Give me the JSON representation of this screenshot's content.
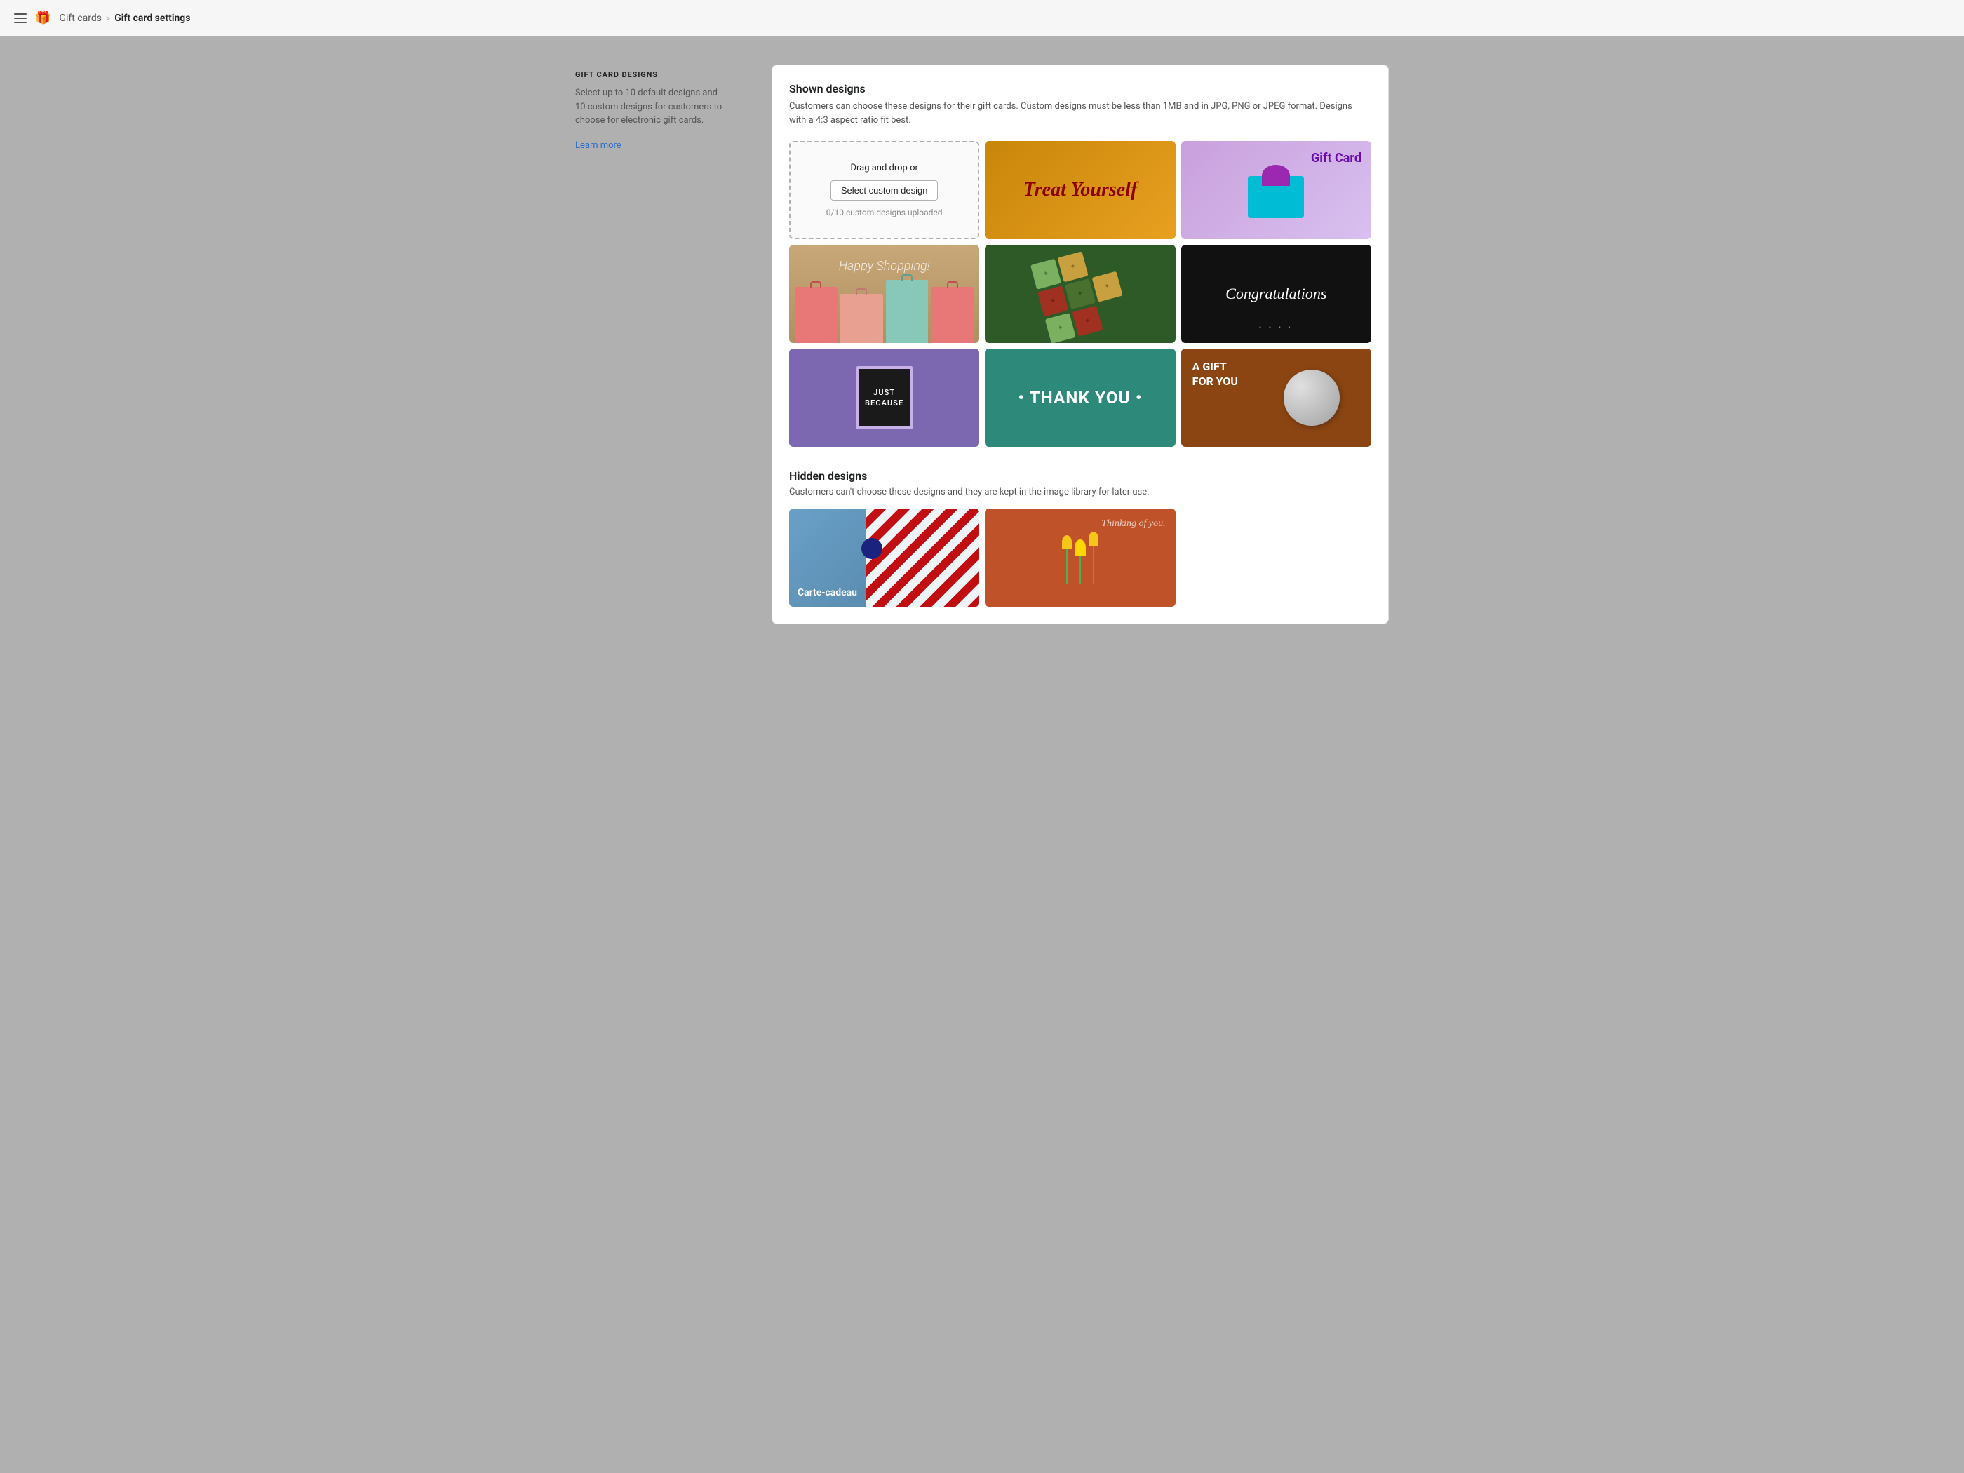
{
  "header": {
    "hamburger_label": "Menu",
    "gift_card_link": "Gift cards",
    "separator": ">",
    "current_page": "Gift card settings"
  },
  "sidebar": {
    "section_title": "GIFT CARD DESIGNS",
    "description": "Select up to 10 default designs and 10 custom designs for customers to choose for electronic gift cards.",
    "learn_more_label": "Learn more"
  },
  "shown_designs": {
    "title": "Shown designs",
    "description": "Customers can choose these designs for their gift cards. Custom designs must be less than 1MB and in JPG, PNG or JPEG format. Designs with a 4:3 aspect ratio fit best.",
    "upload_cell": {
      "drag_drop_text": "Drag and drop or",
      "button_label": "Select custom design",
      "count_text": "0/10 custom designs uploaded"
    },
    "designs": [
      {
        "id": "treat-yourself",
        "alt": "Treat Yourself gift card design"
      },
      {
        "id": "gift-card",
        "alt": "Gift Card with bow design"
      },
      {
        "id": "happy-shopping",
        "alt": "Happy Shopping gift card design"
      },
      {
        "id": "gift-boxes",
        "alt": "Gift boxes design"
      },
      {
        "id": "congratulations",
        "alt": "Congratulations gift card design"
      },
      {
        "id": "just-because",
        "alt": "Just Because letterboard design"
      },
      {
        "id": "thank-you",
        "alt": "Thank You gift card design"
      },
      {
        "id": "gift-for-you",
        "alt": "A Gift For You design"
      }
    ]
  },
  "hidden_designs": {
    "title": "Hidden designs",
    "description": "Customers can't choose these designs and they are kept in the image library for later use.",
    "designs": [
      {
        "id": "carte-cadeau",
        "alt": "Carte-cadeau gift card design",
        "label": "Carte-cadeau"
      },
      {
        "id": "thinking-of-you",
        "alt": "Thinking of you flower design",
        "label": "Thinking of you."
      }
    ]
  },
  "design_texts": {
    "treat_yourself": "Treat Yourself",
    "gift_card": "Gift Card",
    "happy_shopping": "Happy Shopping!",
    "congratulations": "Congratulations",
    "just_because_line1": "JUST",
    "just_because_line2": "BECAUSE",
    "thank_you": "• THANK YOU •",
    "gift_for_you_line1": "A GIFT",
    "gift_for_you_line2": "FOR YOU",
    "carte_cadeau": "Carte-cadeau",
    "thinking_of_you": "Thinking of you."
  }
}
